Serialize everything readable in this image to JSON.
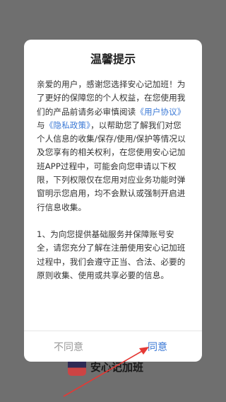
{
  "background_app": {
    "name": "安心记加班"
  },
  "dialog": {
    "title": "温馨提示",
    "para1": {
      "t1": "亲爱的用户，感谢您选择安心记加班！为了更好的保障您的个人权益，在您使用我们的产品前请务必审慎阅读",
      "link1": "《用户协议》",
      "t2": "与",
      "link2": "《隐私政策》",
      "t3": "，以帮助您了解我们对您个人信息的收集/保存/使用/保护等情况以及您享有的相关权利，在您使用安心记加班APP过程中，可能会向您申请以下权限，下列权限仅在您用对应业务功能时弹窗明示您启用，均不会默认或强制开启进行信息收集。"
    },
    "para2": "1、为向您提供基础服务并保障账号安全，请您充分了解在注册使用安心记加班过程中，我们会遵守正当、合法、必要的原则收集、使用或共享必要的信息。",
    "buttons": {
      "disagree": "不同意",
      "agree": "同意"
    }
  },
  "colors": {
    "link": "#3b79d6",
    "annotation_arrow": "#e53935"
  }
}
